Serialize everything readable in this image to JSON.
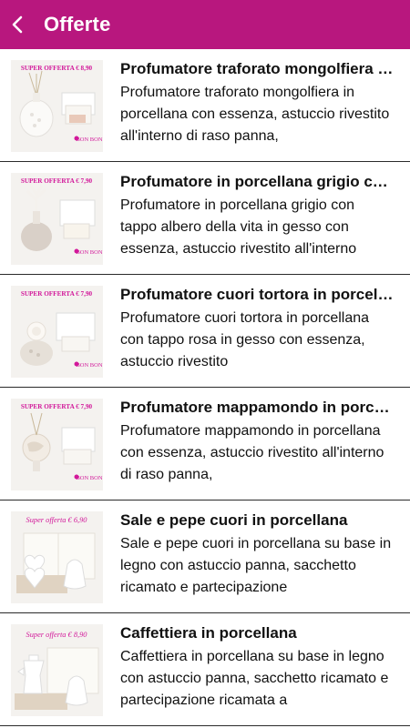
{
  "header": {
    "title": "Offerte",
    "back_icon": "chevron-left-icon",
    "color": "#b8177e"
  },
  "offers": [
    {
      "badge": "SUPER OFFERTA € 8,90",
      "brand": "BON BON",
      "title": "Profumatore traforato mongolfiera in porcellana",
      "description": "Profumatore traforato mongolfiera in porcellana con essenza, astuccio rivestito all'interno di raso panna,"
    },
    {
      "badge": "SUPER OFFERTA € 7,90",
      "brand": "BON BON",
      "title": "Profumatore in porcellana grigio con tappo albero",
      "description": "Profumatore in porcellana grigio con tappo albero della vita in gesso con essenza, astuccio rivestito all'interno"
    },
    {
      "badge": "SUPER OFFERTA € 7,90",
      "brand": "BON BON",
      "title": "Profumatore cuori tortora in porcellana",
      "description": "Profumatore cuori tortora in porcellana con tappo rosa in gesso con essenza, astuccio rivestito"
    },
    {
      "badge": "SUPER OFFERTA € 7,90",
      "brand": "BON BON",
      "title": "Profumatore mappamondo in porcellana",
      "description": "Profumatore mappamondo in porcellana con essenza, astuccio rivestito all'interno di raso panna,"
    },
    {
      "badge": "Super offerta € 6,90",
      "brand": "",
      "title": "Sale e pepe cuori in porcellana",
      "description": "Sale e pepe cuori in porcellana su base in legno con astuccio panna, sacchetto ricamato e partecipazione"
    },
    {
      "badge": "Super offerta € 8,90",
      "brand": "",
      "title": "Caffettiera in porcellana",
      "description": "Caffettiera in porcellana su base in legno con astuccio panna, sacchetto ricamato e partecipazione ricamata a"
    }
  ]
}
